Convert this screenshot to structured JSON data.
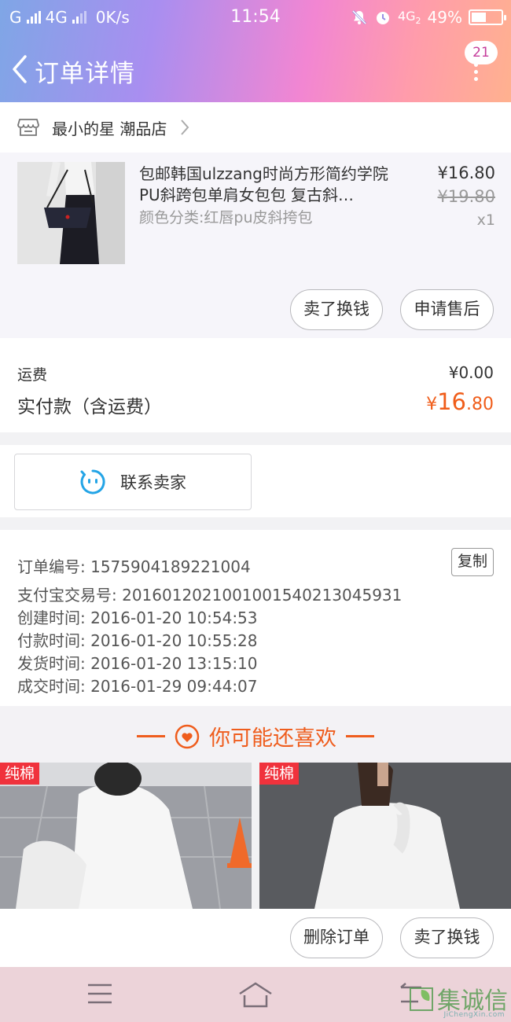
{
  "status_bar": {
    "carrier1": "G",
    "carrier2": "4G",
    "speed": "0K/s",
    "time": "11:54",
    "network": "4G",
    "network_sub": "2",
    "battery": "49%",
    "battery_fraction": 0.49
  },
  "header": {
    "title": "订单详情",
    "message_count": "21"
  },
  "shop": {
    "name": "最小的星 潮品店"
  },
  "product": {
    "title": "包邮韩国ulzzang时尚方形简约学院PU斜跨包单肩女包包 复古斜…",
    "sku": "颜色分类:红唇pu皮斜挎包",
    "price": "¥16.80",
    "original_price": "¥19.80",
    "quantity": "x1",
    "btn_sell": "卖了换钱",
    "btn_aftersale": "申请售后"
  },
  "fees": {
    "shipping_label": "运费",
    "shipping_value": "¥0.00",
    "paid_label": "实付款（含运费）",
    "paid_symbol": "¥",
    "paid_int": "16",
    "paid_dec": ".80"
  },
  "contact": {
    "label": "联系卖家"
  },
  "order_info": {
    "order_no": "订单编号: 1575904189221004",
    "copy": "复制",
    "alipay_no": "支付宝交易号: 2016012021001001540213045931",
    "created": "创建时间: 2016-01-20 10:54:53",
    "paid": "付款时间: 2016-01-20 10:55:28",
    "shipped": "发货时间: 2016-01-20 13:15:10",
    "completed": "成交时间: 2016-01-29 09:44:07"
  },
  "recommend": {
    "title": "你可能还喜欢",
    "items": [
      {
        "tag": "纯棉"
      },
      {
        "tag": "纯棉"
      }
    ]
  },
  "actions": {
    "delete": "删除订单",
    "sell": "卖了换钱"
  },
  "watermark": {
    "cn": "集诚信",
    "en": "JiChengXin.com"
  },
  "colors": {
    "accent_orange": "#f05d1a",
    "tag_red": "#f0323c",
    "badge_text": "#c53c9b"
  }
}
